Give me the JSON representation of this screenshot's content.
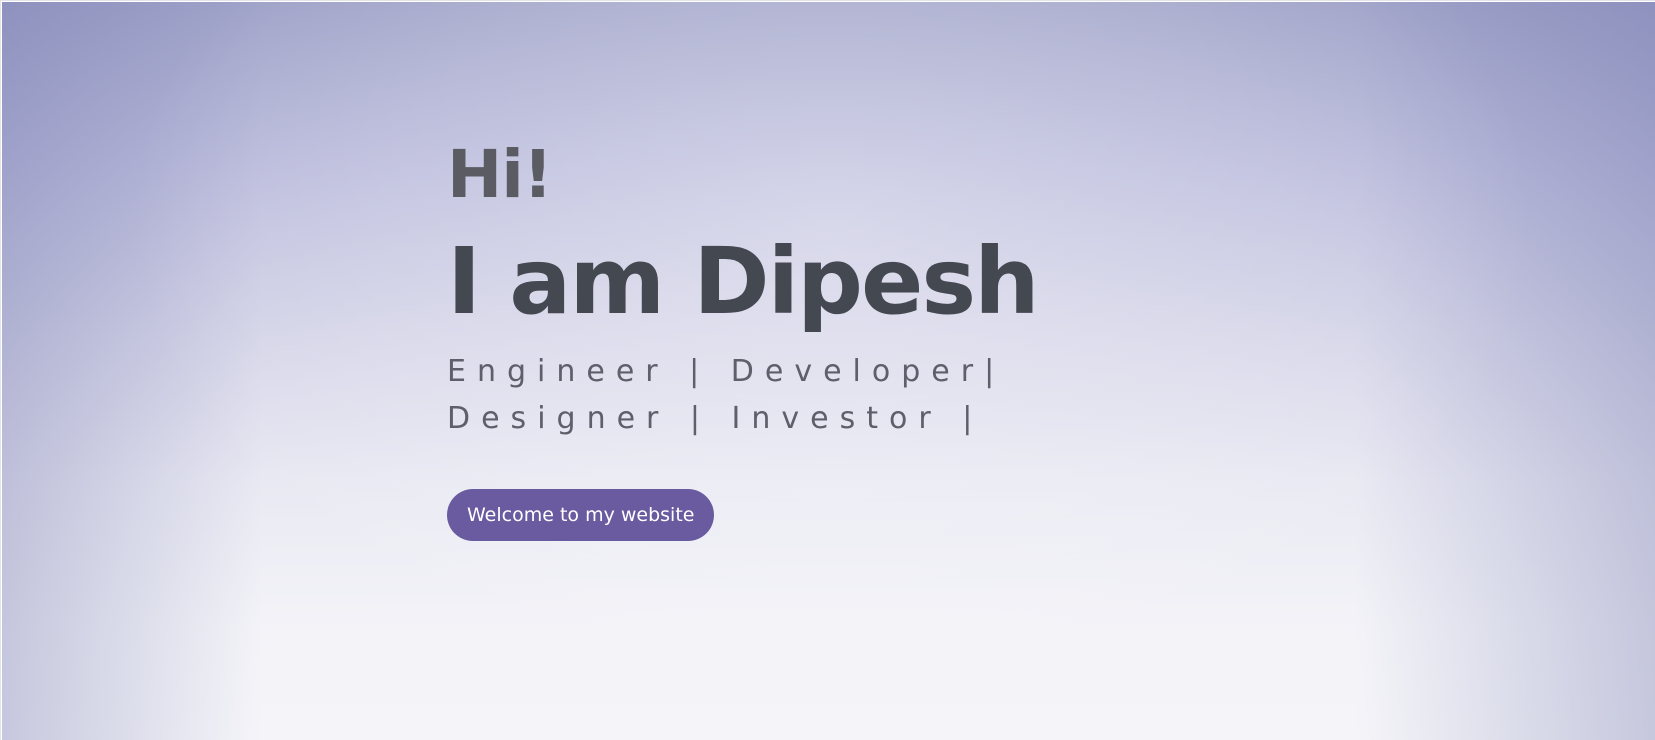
{
  "hero": {
    "greeting": "Hi!",
    "name": "I am Dipesh",
    "roles_line1": "Engineer | Developer|",
    "roles_line2": "Designer | Investor |",
    "cta_label": "Welcome to my website"
  },
  "colors": {
    "accent": "#6a5aa0",
    "heading": "#444851",
    "greeting": "#5b5c63",
    "background_top": "#9fa2c8",
    "background_bottom": "#f5f5f9"
  }
}
